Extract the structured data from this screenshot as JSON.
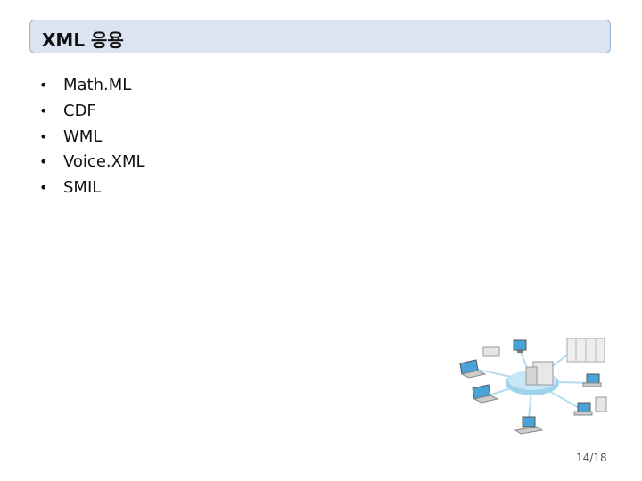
{
  "slide": {
    "title": "XML 응용",
    "bullet_symbol": "•",
    "bullets": [
      "Math.ML",
      "CDF",
      "WML",
      "Voice.XML",
      "SMIL"
    ],
    "page_number": "14/18"
  },
  "colors": {
    "title_fill": "#dbe5f1",
    "title_border": "#95b3d7",
    "hub": "#9fd3ec",
    "screen": "#4aa3d8"
  },
  "illustration": {
    "icon": "network-diagram-icon"
  }
}
